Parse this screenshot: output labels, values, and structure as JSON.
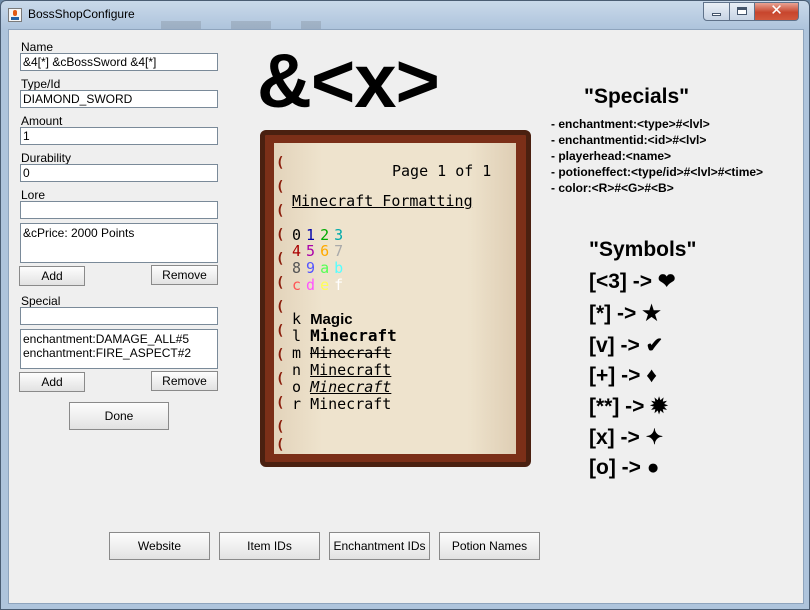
{
  "window": {
    "title": "BossShopConfigure",
    "close_glyph": "✕"
  },
  "form": {
    "name_label": "Name",
    "name_value": "&4[*] &cBossSword &4[*]",
    "type_label": "Type/Id",
    "type_value": "DIAMOND_SWORD",
    "amount_label": "Amount",
    "amount_value": "1",
    "durability_label": "Durability",
    "durability_value": "0",
    "lore_label": "Lore",
    "lore_input": "",
    "lore_items": [
      "&cPrice: 2000 Points"
    ],
    "special_label": "Special",
    "special_input": "",
    "special_items": [
      "enchantment:DAMAGE_ALL#5",
      "enchantment:FIRE_ASPECT#2"
    ],
    "add_label": "Add",
    "remove_label": "Remove",
    "done_label": "Done"
  },
  "big_symbol": "&<x>",
  "book": {
    "page": "Page 1 of 1",
    "heading": "Minecraft Formatting",
    "colors": [
      [
        {
          "c": "0",
          "hex": "#000000"
        },
        {
          "c": "1",
          "hex": "#0000aa"
        },
        {
          "c": "2",
          "hex": "#00aa00"
        },
        {
          "c": "3",
          "hex": "#00aaaa"
        }
      ],
      [
        {
          "c": "4",
          "hex": "#aa0000"
        },
        {
          "c": "5",
          "hex": "#aa00aa"
        },
        {
          "c": "6",
          "hex": "#ffaa00"
        },
        {
          "c": "7",
          "hex": "#aaaaaa"
        }
      ],
      [
        {
          "c": "8",
          "hex": "#555555"
        },
        {
          "c": "9",
          "hex": "#5555ff"
        },
        {
          "c": "a",
          "hex": "#55ff55"
        },
        {
          "c": "b",
          "hex": "#55ffff"
        }
      ],
      [
        {
          "c": "c",
          "hex": "#ff5555"
        },
        {
          "c": "d",
          "hex": "#ff55ff"
        },
        {
          "c": "e",
          "hex": "#ffff55"
        },
        {
          "c": "f",
          "hex": "#ffffff"
        }
      ]
    ],
    "formats": [
      {
        "code": "k",
        "text": "Magic"
      },
      {
        "code": "l",
        "text": "Minecraft"
      },
      {
        "code": "m",
        "text": "Minecraft"
      },
      {
        "code": "n",
        "text": "Minecraft"
      },
      {
        "code": "o",
        "text": "Minecraft"
      },
      {
        "code": "r",
        "text": "Minecraft"
      }
    ],
    "bind_glyph": "("
  },
  "specials": {
    "title": "\"Specials\"",
    "items": [
      "- enchantment:<type>#<lvl>",
      "- enchantmentid:<id>#<lvl>",
      "- playerhead:<name>",
      "- potioneffect:<type/id>#<lvl>#<time>",
      "- color:<R>#<G>#<B>"
    ]
  },
  "symbols": {
    "title": "\"Symbols\"",
    "items": [
      {
        "code": "[<3] -> ",
        "glyph": "❤"
      },
      {
        "code": "[*] -> ",
        "glyph": "★"
      },
      {
        "code": "[v] -> ",
        "glyph": "✔"
      },
      {
        "code": "[+] -> ",
        "glyph": "♦"
      },
      {
        "code": "[**] -> ",
        "glyph": "✹"
      },
      {
        "code": "[x] -> ",
        "glyph": "✦"
      },
      {
        "code": "[o] -> ",
        "glyph": "●"
      }
    ]
  },
  "buttons": {
    "website": "Website",
    "item_ids": "Item IDs",
    "enchantment_ids": "Enchantment IDs",
    "potion_names": "Potion Names"
  }
}
